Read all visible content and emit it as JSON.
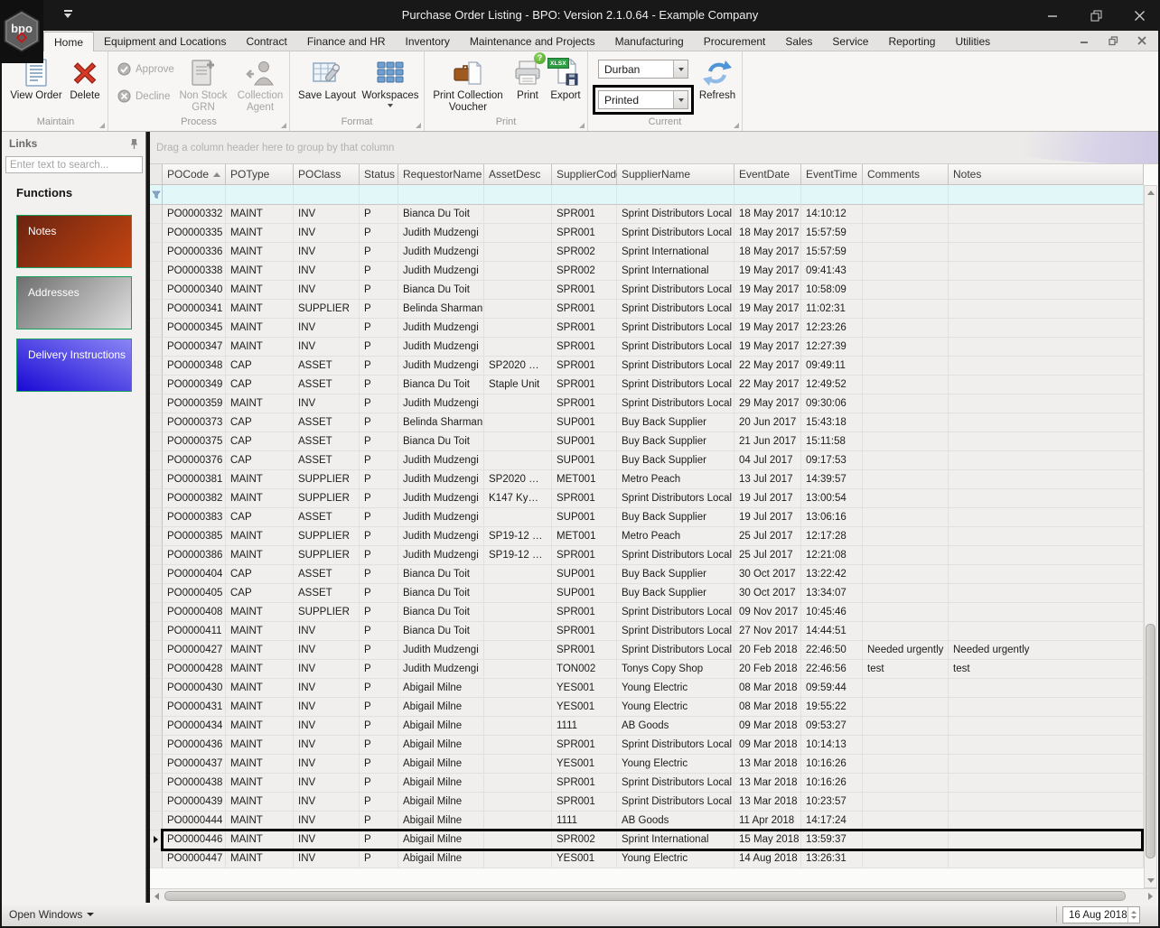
{
  "titlebar": {
    "title": "Purchase Order Listing - BPO: Version 2.1.0.64 - Example Company",
    "logo_text": "bpo"
  },
  "tabs": {
    "items": [
      "Home",
      "Equipment and Locations",
      "Contract",
      "Finance and HR",
      "Inventory",
      "Maintenance and Projects",
      "Manufacturing",
      "Procurement",
      "Sales",
      "Service",
      "Reporting",
      "Utilities"
    ],
    "active": "Home"
  },
  "ribbon": {
    "maintain": {
      "label": "Maintain",
      "view_order": "View Order",
      "delete": "Delete"
    },
    "process": {
      "label": "Process",
      "approve": "Approve",
      "decline": "Decline",
      "non_stock_grn": "Non Stock GRN",
      "collection_agent": "Collection Agent"
    },
    "format": {
      "label": "Format",
      "save_layout": "Save Layout",
      "workspaces": "Workspaces"
    },
    "print": {
      "label": "Print",
      "print_collection_voucher": "Print Collection Voucher",
      "print": "Print",
      "export": "Export"
    },
    "current": {
      "label": "Current",
      "site_value": "Durban",
      "status_value": "Printed",
      "refresh": "Refresh"
    }
  },
  "icons": {
    "print_badge": "?",
    "export_badge": "XLSX"
  },
  "sidebar": {
    "panel_title": "Links",
    "search_placeholder": "Enter text to search...",
    "functions_label": "Functions",
    "tiles": [
      {
        "label": "Notes"
      },
      {
        "label": "Addresses"
      },
      {
        "label": "Delivery Instructions"
      }
    ]
  },
  "grid": {
    "group_hint": "Drag a column header here to group by that column",
    "columns": [
      "POCode",
      "POType",
      "POClass",
      "Status",
      "RequestorName",
      "AssetDesc",
      "SupplierCode",
      "SupplierName",
      "EventDate",
      "EventTime",
      "Comments",
      "Notes"
    ],
    "sorted_column": "POCode",
    "sort_direction": "asc",
    "selected_po": "PO0000446",
    "rows": [
      [
        "PO0000332",
        "MAINT",
        "INV",
        "P",
        "Bianca Du Toit",
        "",
        "SPR001",
        "Sprint Distributors Local",
        "18 May 2017",
        "14:10:12",
        "",
        ""
      ],
      [
        "PO0000335",
        "MAINT",
        "INV",
        "P",
        "Judith Mudzengi",
        "",
        "SPR001",
        "Sprint Distributors Local",
        "18 May 2017",
        "15:57:59",
        "",
        ""
      ],
      [
        "PO0000336",
        "MAINT",
        "INV",
        "P",
        "Judith Mudzengi",
        "",
        "SPR002",
        "Sprint International",
        "18 May 2017",
        "15:57:59",
        "",
        ""
      ],
      [
        "PO0000338",
        "MAINT",
        "INV",
        "P",
        "Judith Mudzengi",
        "",
        "SPR002",
        "Sprint International",
        "19 May 2017",
        "09:41:43",
        "",
        ""
      ],
      [
        "PO0000340",
        "MAINT",
        "INV",
        "P",
        "Bianca Du Toit",
        "",
        "SPR001",
        "Sprint Distributors Local",
        "19 May 2017",
        "10:58:09",
        "",
        ""
      ],
      [
        "PO0000341",
        "MAINT",
        "SUPPLIER",
        "P",
        "Belinda Sharman",
        "",
        "SPR001",
        "Sprint Distributors Local",
        "19 May 2017",
        "11:02:31",
        "",
        ""
      ],
      [
        "PO0000345",
        "MAINT",
        "INV",
        "P",
        "Judith Mudzengi",
        "",
        "SPR001",
        "Sprint Distributors Local",
        "19 May 2017",
        "12:23:26",
        "",
        ""
      ],
      [
        "PO0000347",
        "MAINT",
        "INV",
        "P",
        "Judith Mudzengi",
        "",
        "SPR001",
        "Sprint Distributors Local",
        "19 May 2017",
        "12:27:39",
        "",
        ""
      ],
      [
        "PO0000348",
        "CAP",
        "ASSET",
        "P",
        "Judith Mudzengi",
        "SP2020 …",
        "SPR001",
        "Sprint Distributors Local",
        "22 May 2017",
        "09:49:11",
        "",
        ""
      ],
      [
        "PO0000349",
        "CAP",
        "ASSET",
        "P",
        "Bianca Du Toit",
        "Staple Unit",
        "SPR001",
        "Sprint Distributors Local",
        "22 May 2017",
        "12:49:52",
        "",
        ""
      ],
      [
        "PO0000359",
        "MAINT",
        "INV",
        "P",
        "Judith Mudzengi",
        "",
        "SPR001",
        "Sprint Distributors Local",
        "29 May 2017",
        "09:30:06",
        "",
        ""
      ],
      [
        "PO0000373",
        "CAP",
        "ASSET",
        "P",
        "Belinda Sharman",
        "",
        "SUP001",
        "Buy Back Supplier",
        "20 Jun 2017",
        "15:43:18",
        "",
        ""
      ],
      [
        "PO0000375",
        "CAP",
        "ASSET",
        "P",
        "Bianca Du Toit",
        "",
        "SUP001",
        "Buy Back Supplier",
        "21 Jun 2017",
        "15:11:58",
        "",
        ""
      ],
      [
        "PO0000376",
        "CAP",
        "ASSET",
        "P",
        "Judith Mudzengi",
        "",
        "SUP001",
        "Buy Back Supplier",
        "04 Jul 2017",
        "09:17:53",
        "",
        ""
      ],
      [
        "PO0000381",
        "MAINT",
        "SUPPLIER",
        "P",
        "Judith Mudzengi",
        "SP2020 …",
        "MET001",
        "Metro Peach",
        "13 Jul 2017",
        "14:39:57",
        "",
        ""
      ],
      [
        "PO0000382",
        "MAINT",
        "SUPPLIER",
        "P",
        "Judith Mudzengi",
        "K147 Ky…",
        "SPR001",
        "Sprint Distributors Local",
        "19 Jul 2017",
        "13:00:54",
        "",
        ""
      ],
      [
        "PO0000383",
        "CAP",
        "ASSET",
        "P",
        "Judith Mudzengi",
        "",
        "SUP001",
        "Buy Back Supplier",
        "19 Jul 2017",
        "13:06:16",
        "",
        ""
      ],
      [
        "PO0000385",
        "MAINT",
        "SUPPLIER",
        "P",
        "Judith Mudzengi",
        "SP19-12 …",
        "MET001",
        "Metro Peach",
        "25 Jul 2017",
        "12:17:28",
        "",
        ""
      ],
      [
        "PO0000386",
        "MAINT",
        "SUPPLIER",
        "P",
        "Judith Mudzengi",
        "SP19-12 …",
        "SPR001",
        "Sprint Distributors Local",
        "25 Jul 2017",
        "12:21:08",
        "",
        ""
      ],
      [
        "PO0000404",
        "CAP",
        "ASSET",
        "P",
        "Bianca Du Toit",
        "",
        "SUP001",
        "Buy Back Supplier",
        "30 Oct 2017",
        "13:22:42",
        "",
        ""
      ],
      [
        "PO0000405",
        "CAP",
        "ASSET",
        "P",
        "Bianca Du Toit",
        "",
        "SUP001",
        "Buy Back Supplier",
        "30 Oct 2017",
        "13:34:07",
        "",
        ""
      ],
      [
        "PO0000408",
        "MAINT",
        "SUPPLIER",
        "P",
        "Bianca Du Toit",
        "",
        "SPR001",
        "Sprint Distributors Local",
        "09 Nov 2017",
        "10:45:46",
        "",
        ""
      ],
      [
        "PO0000411",
        "MAINT",
        "INV",
        "P",
        "Bianca Du Toit",
        "",
        "SPR001",
        "Sprint Distributors Local",
        "27 Nov 2017",
        "14:44:51",
        "",
        ""
      ],
      [
        "PO0000427",
        "MAINT",
        "INV",
        "P",
        "Judith Mudzengi",
        "",
        "SPR001",
        "Sprint Distributors Local",
        "20 Feb 2018",
        "22:46:50",
        "Needed urgently",
        "Needed urgently"
      ],
      [
        "PO0000428",
        "MAINT",
        "INV",
        "P",
        "Judith Mudzengi",
        "",
        "TON002",
        "Tonys Copy Shop",
        "20 Feb 2018",
        "22:46:56",
        "test",
        "test"
      ],
      [
        "PO0000430",
        "MAINT",
        "INV",
        "P",
        "Abigail Milne",
        "",
        "YES001",
        "Young Electric",
        "08 Mar 2018",
        "09:59:44",
        "",
        ""
      ],
      [
        "PO0000431",
        "MAINT",
        "INV",
        "P",
        "Abigail Milne",
        "",
        "YES001",
        "Young Electric",
        "08 Mar 2018",
        "19:55:22",
        "",
        ""
      ],
      [
        "PO0000434",
        "MAINT",
        "INV",
        "P",
        "Abigail Milne",
        "",
        "1111",
        "AB Goods",
        "09 Mar 2018",
        "09:53:27",
        "",
        ""
      ],
      [
        "PO0000436",
        "MAINT",
        "INV",
        "P",
        "Abigail Milne",
        "",
        "SPR001",
        "Sprint Distributors Local",
        "09 Mar 2018",
        "10:14:13",
        "",
        ""
      ],
      [
        "PO0000437",
        "MAINT",
        "INV",
        "P",
        "Abigail Milne",
        "",
        "YES001",
        "Young Electric",
        "13 Mar 2018",
        "10:16:26",
        "",
        ""
      ],
      [
        "PO0000438",
        "MAINT",
        "INV",
        "P",
        "Abigail Milne",
        "",
        "SPR001",
        "Sprint Distributors Local",
        "13 Mar 2018",
        "10:16:26",
        "",
        ""
      ],
      [
        "PO0000439",
        "MAINT",
        "INV",
        "P",
        "Abigail Milne",
        "",
        "SPR001",
        "Sprint Distributors Local",
        "13 Mar 2018",
        "10:23:57",
        "",
        ""
      ],
      [
        "PO0000444",
        "MAINT",
        "INV",
        "P",
        "Abigail Milne",
        "",
        "1111",
        "AB Goods",
        "11 Apr 2018",
        "14:17:24",
        "",
        ""
      ],
      [
        "PO0000446",
        "MAINT",
        "INV",
        "P",
        "Abigail Milne",
        "",
        "SPR002",
        "Sprint International",
        "15 May 2018",
        "13:59:37",
        "",
        ""
      ],
      [
        "PO0000447",
        "MAINT",
        "INV",
        "P",
        "Abigail Milne",
        "",
        "YES001",
        "Young Electric",
        "14 Aug 2018",
        "13:26:31",
        "",
        ""
      ]
    ]
  },
  "statusbar": {
    "open_windows": "Open Windows",
    "date_value": "16 Aug 2018"
  },
  "colors": {
    "annotation": "#000000",
    "notes_tile": [
      "#6b2310",
      "#c44511"
    ],
    "addresses_tile": [
      "#6e6e6e",
      "#e0e0e0"
    ],
    "delivery_tile": [
      "#8a85f5",
      "#1a0ad5"
    ],
    "tile_border": "#17a05e",
    "filter_row": "#e2f8f8",
    "titlebar_bg": "#181818",
    "workspaces_blue": "#6fa0d0",
    "refresh_blue": "#4f94d6",
    "delete_red": "#d43a28"
  }
}
